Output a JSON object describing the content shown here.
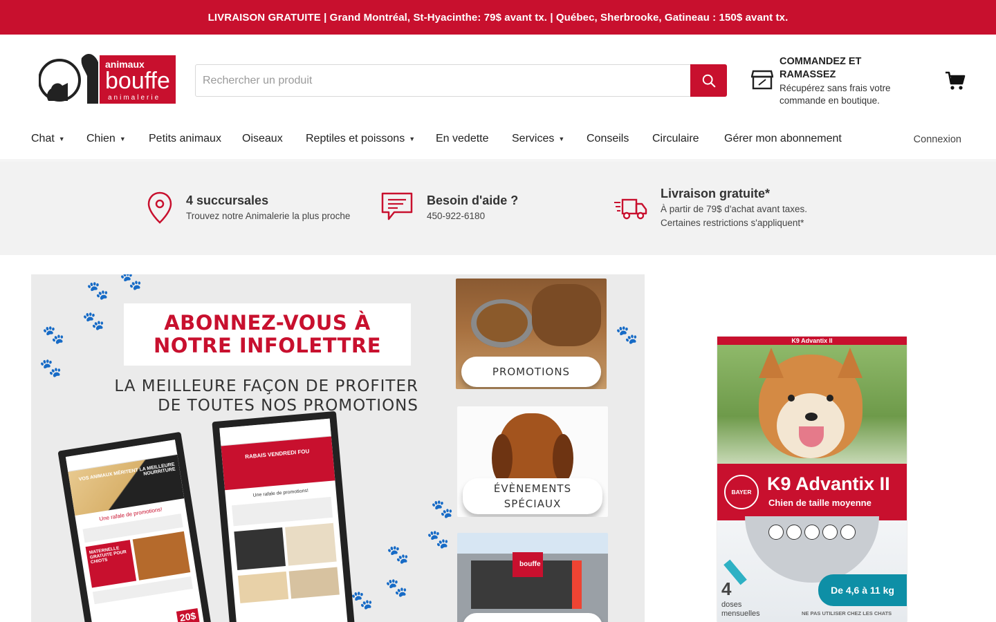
{
  "announcement": "LIVRAISON GRATUITE | Grand Montréal, St-Hyacinthe: 79$ avant tx. | Québec, Sherbrooke, Gatineau : 150$ avant tx.",
  "logo": {
    "brand_top": "animaux",
    "brand_main": "bouffe",
    "brand_sub": "animalerie",
    "initials": "ab"
  },
  "search": {
    "placeholder": "Rechercher un produit"
  },
  "pickup": {
    "title": "COMMANDEZ ET RAMASSEZ",
    "description": "Récupérez sans frais votre commande en boutique."
  },
  "nav": {
    "items": [
      {
        "label": "Chat",
        "dropdown": true
      },
      {
        "label": "Chien",
        "dropdown": true
      },
      {
        "label": "Petits animaux",
        "dropdown": false
      },
      {
        "label": "Oiseaux",
        "dropdown": false
      },
      {
        "label": "Reptiles et poissons",
        "dropdown": true
      },
      {
        "label": "En vedette",
        "dropdown": false
      },
      {
        "label": "Services",
        "dropdown": true
      },
      {
        "label": "Conseils",
        "dropdown": false
      },
      {
        "label": "Circulaire",
        "dropdown": false
      },
      {
        "label": "Gérer mon abonnement",
        "dropdown": false
      }
    ],
    "login": "Connexion"
  },
  "info": {
    "stores": {
      "title": "4 succursales",
      "subtitle": "Trouvez notre Animalerie la plus proche",
      "icon": "map-pin-icon"
    },
    "help": {
      "title": "Besoin d'aide ?",
      "phone": "450-922-6180",
      "icon": "chat-icon"
    },
    "delivery": {
      "title": "Livraison gratuite*",
      "line1": "À partir de 79$ d'achat avant taxes.",
      "line2": "Certaines restrictions s'appliquent*",
      "icon": "delivery-truck-icon"
    }
  },
  "banner": {
    "title_line1": "ABONNEZ-VOUS À",
    "title_line2": "NOTRE INFOLETTRE",
    "subtitle_line1": "LA MEILLEURE FAÇON DE PROFITER",
    "subtitle_line2": "DE TOUTES NOS PROMOTIONS",
    "cards": [
      {
        "label": "PROMOTIONS"
      },
      {
        "label_line1": "ÉVÈNEMENTS",
        "label_line2": "SPÉCIAUX"
      },
      {
        "label": ""
      }
    ],
    "phone_left_heading": "VOS ANIMAUX MÉRITENT LA MEILLEURE NOURRITURE",
    "phone_left_sub": "Une rafale de promotions!",
    "phone_left_badge": "MATERNELLE GRATUITE POUR CHIOTS",
    "phone_left_price": "20$",
    "phone_right_heading": "RABAIS VENDREDI FOU",
    "phone_right_sub": "Une rafale de promotions!"
  },
  "product": {
    "brand": "BAYER",
    "name": "K9 Advantix",
    "name_suffix": "II",
    "subtitle": "Chien de taille moyenne",
    "weight": "De 4,6 à 11 kg",
    "doses_count": "4",
    "doses_label": "doses mensuelles",
    "warning": "NE PAS UTILISER CHEZ LES CHATS",
    "top_band": "K9 Advantix II"
  },
  "colors": {
    "brand_red": "#c8102e",
    "info_bg": "#f2f2f2",
    "product_teal": "#0e8fa6"
  }
}
